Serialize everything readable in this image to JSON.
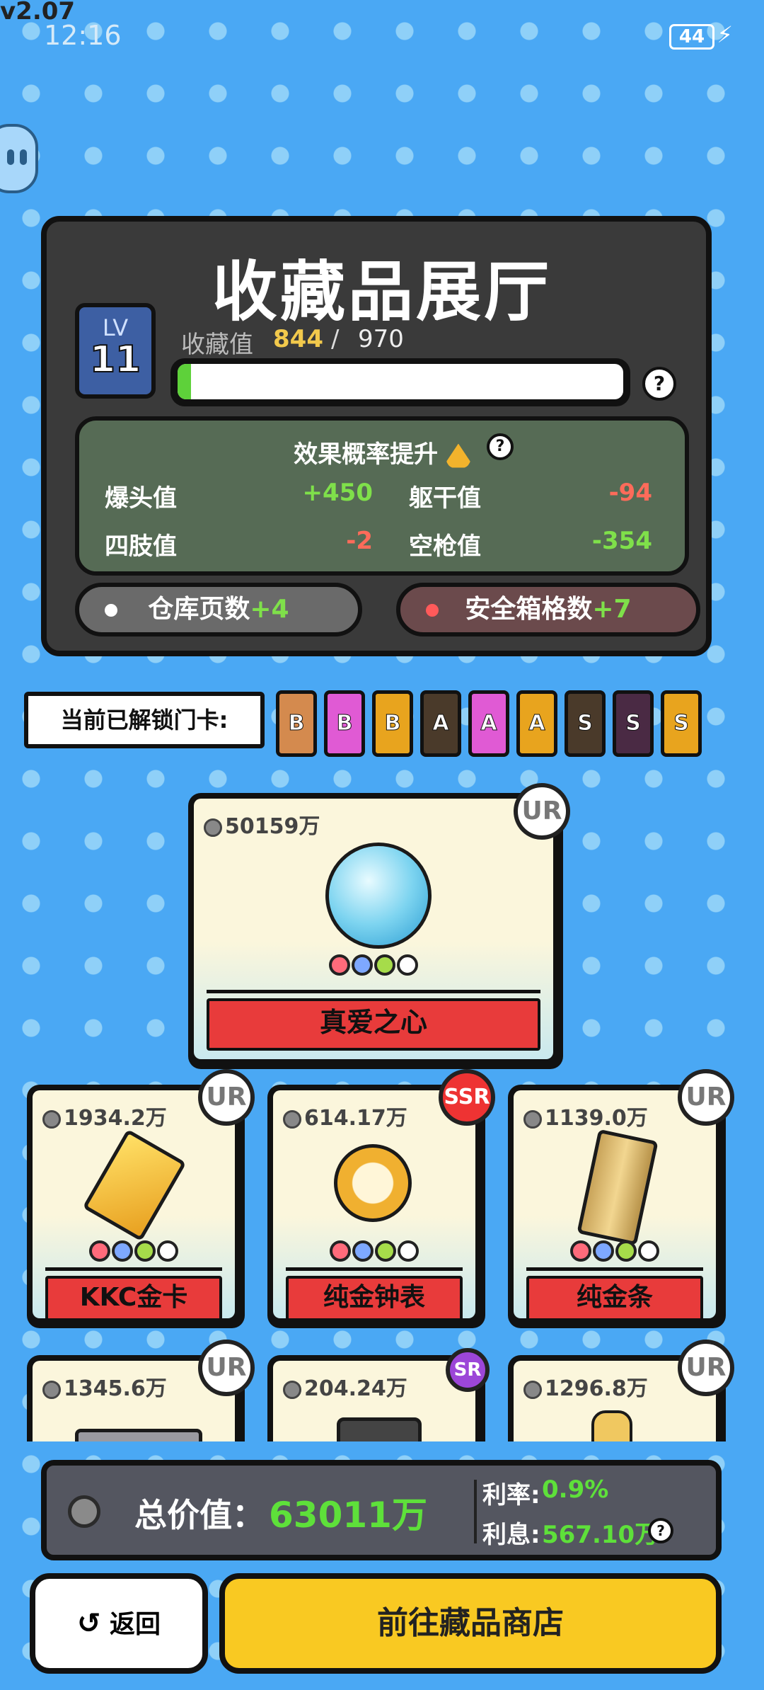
{
  "status": {
    "version": "v2.07",
    "time": "12:16",
    "battery": "44"
  },
  "hall": {
    "title": "收藏品展厅",
    "level_label": "LV",
    "level": "11",
    "collect_label": "收藏值",
    "collect_current": "844",
    "collect_sep": "/",
    "collect_max": "970",
    "progress_fraction": 0.03,
    "help": "?"
  },
  "effect": {
    "title": "效果概率提升",
    "rows": [
      {
        "label": "爆头值",
        "value": "+450"
      },
      {
        "label": "躯干值",
        "value": "-94"
      },
      {
        "label": "四肢值",
        "value": "-2"
      },
      {
        "label": "空枪值",
        "value": "-354"
      }
    ]
  },
  "bonus": {
    "warehouse_label": "仓库页数",
    "warehouse_value": "+4",
    "safebox_label": "安全箱格数",
    "safebox_value": "+7"
  },
  "unlock": {
    "label": "当前已解锁门卡:",
    "cards": [
      {
        "letter": "B",
        "color": "#d48a4e"
      },
      {
        "letter": "B",
        "color": "#e05ad4"
      },
      {
        "letter": "B",
        "color": "#e8a41e"
      },
      {
        "letter": "A",
        "color": "#4a3a2a"
      },
      {
        "letter": "A",
        "color": "#e05ad4"
      },
      {
        "letter": "A",
        "color": "#e8a41e"
      },
      {
        "letter": "S",
        "color": "#4a3a2a"
      },
      {
        "letter": "S",
        "color": "#4a2a44"
      },
      {
        "letter": "S",
        "color": "#e8a41e"
      }
    ]
  },
  "items": [
    {
      "price": "50159万",
      "rarity": "UR",
      "name": "真爱之心",
      "icon": "diamond-icon"
    },
    {
      "price": "1934.2万",
      "rarity": "UR",
      "name": "KKC金卡",
      "icon": "gold-card-icon"
    },
    {
      "price": "614.17万",
      "rarity": "SSR",
      "name": "纯金钟表",
      "icon": "pocket-watch-icon"
    },
    {
      "price": "1139.0万",
      "rarity": "UR",
      "name": "纯金条",
      "icon": "gold-bar-icon"
    },
    {
      "price": "1345.6万",
      "rarity": "UR",
      "name": "",
      "icon": "gpu-icon"
    },
    {
      "price": "204.24万",
      "rarity": "SR",
      "name": "",
      "icon": "device-icon"
    },
    {
      "price": "1296.8万",
      "rarity": "UR",
      "name": "",
      "icon": "statue-icon"
    }
  ],
  "summary": {
    "total_label": "总价值：",
    "total_value": "63011万",
    "rate_label": "利率:",
    "rate_value": "0.9%",
    "interest_label": "利息:",
    "interest_value": "567.10万"
  },
  "buttons": {
    "back": "返回",
    "shop": "前往藏品商店"
  }
}
